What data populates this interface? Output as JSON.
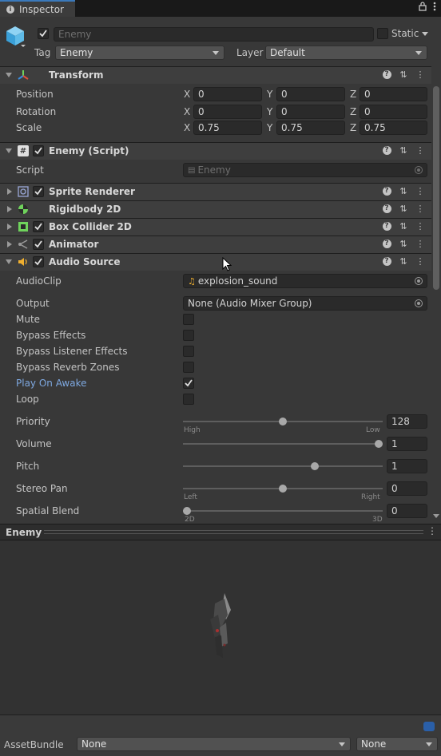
{
  "tab": {
    "label": "Inspector"
  },
  "header": {
    "name": "Enemy",
    "static_label": "Static",
    "tag_label": "Tag",
    "tag_value": "Enemy",
    "layer_label": "Layer",
    "layer_value": "Default"
  },
  "transform": {
    "title": "Transform",
    "rows": [
      {
        "label": "Position",
        "x": "0",
        "y": "0",
        "z": "0"
      },
      {
        "label": "Rotation",
        "x": "0",
        "y": "0",
        "z": "0"
      },
      {
        "label": "Scale",
        "x": "0.75",
        "y": "0.75",
        "z": "0.75"
      }
    ],
    "axes": {
      "x": "X",
      "y": "Y",
      "z": "Z"
    }
  },
  "script_comp": {
    "title": "Enemy (Script)",
    "script_label": "Script",
    "script_value": "Enemy"
  },
  "components": {
    "sprite_renderer": "Sprite Renderer",
    "rigidbody": "Rigidbody 2D",
    "box_collider": "Box Collider 2D",
    "animator": "Animator"
  },
  "audio": {
    "title": "Audio Source",
    "audioclip_label": "AudioClip",
    "audioclip_value": "explosion_sound",
    "output_label": "Output",
    "output_value": "None (Audio Mixer Group)",
    "mute": "Mute",
    "bypass_effects": "Bypass Effects",
    "bypass_listener": "Bypass Listener Effects",
    "bypass_reverb": "Bypass Reverb Zones",
    "play_on_awake": "Play On Awake",
    "loop": "Loop",
    "priority_label": "Priority",
    "priority_value": "128",
    "priority_min": "High",
    "priority_max": "Low",
    "volume_label": "Volume",
    "volume_value": "1",
    "pitch_label": "Pitch",
    "pitch_value": "1",
    "stereo_label": "Stereo Pan",
    "stereo_value": "0",
    "stereo_min": "Left",
    "stereo_max": "Right",
    "spatial_label": "Spatial Blend",
    "spatial_value": "0",
    "spatial_min": "2D",
    "spatial_max": "3D"
  },
  "preview": {
    "title": "Enemy"
  },
  "bottom": {
    "assetbundle_label": "AssetBundle",
    "bundle_value": "None",
    "variant_value": "None"
  },
  "colors": {
    "accent": "#3a79bb",
    "link": "#7ea8e0"
  }
}
